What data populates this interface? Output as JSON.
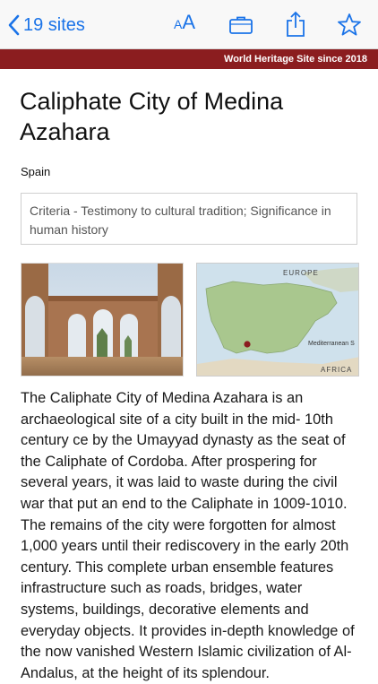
{
  "nav": {
    "back_label": "19 sites",
    "icons": [
      "chevron-left-icon",
      "font-size-icon",
      "briefcase-icon",
      "share-icon",
      "star-icon"
    ],
    "accent_color": "#1a73e8"
  },
  "banner": {
    "text": "World Heritage Site since 2018",
    "color": "#8b1d1f"
  },
  "site": {
    "title": "Caliphate City of Medina Azahara",
    "country": "Spain",
    "criteria": "Criteria - Testimony to cultural tradition; Significance in human history",
    "description": "The Caliphate City of Medina Azahara is an archaeological site of a city built in the mid- 10th century ce by the Umayyad dynasty as the seat of the Caliphate of Cordoba. After prospering for several years, it was laid to waste during the civil war that put an end to the Caliphate in 1009-1010. The remains of the city were forgotten for almost 1,000 years until their rediscovery in the early 20th century. This complete urban ensemble features infrastructure such as roads, bridges, water systems, buildings, decorative elements and everyday objects. It provides in-depth knowledge of the now vanished Western Islamic civilization of Al-Andalus, at the height of its splendour."
  },
  "map": {
    "label_europe": "EUROPE",
    "label_sea": "Mediterranean S",
    "label_africa": "AFRICA",
    "marker_color": "#8b1d1f"
  }
}
